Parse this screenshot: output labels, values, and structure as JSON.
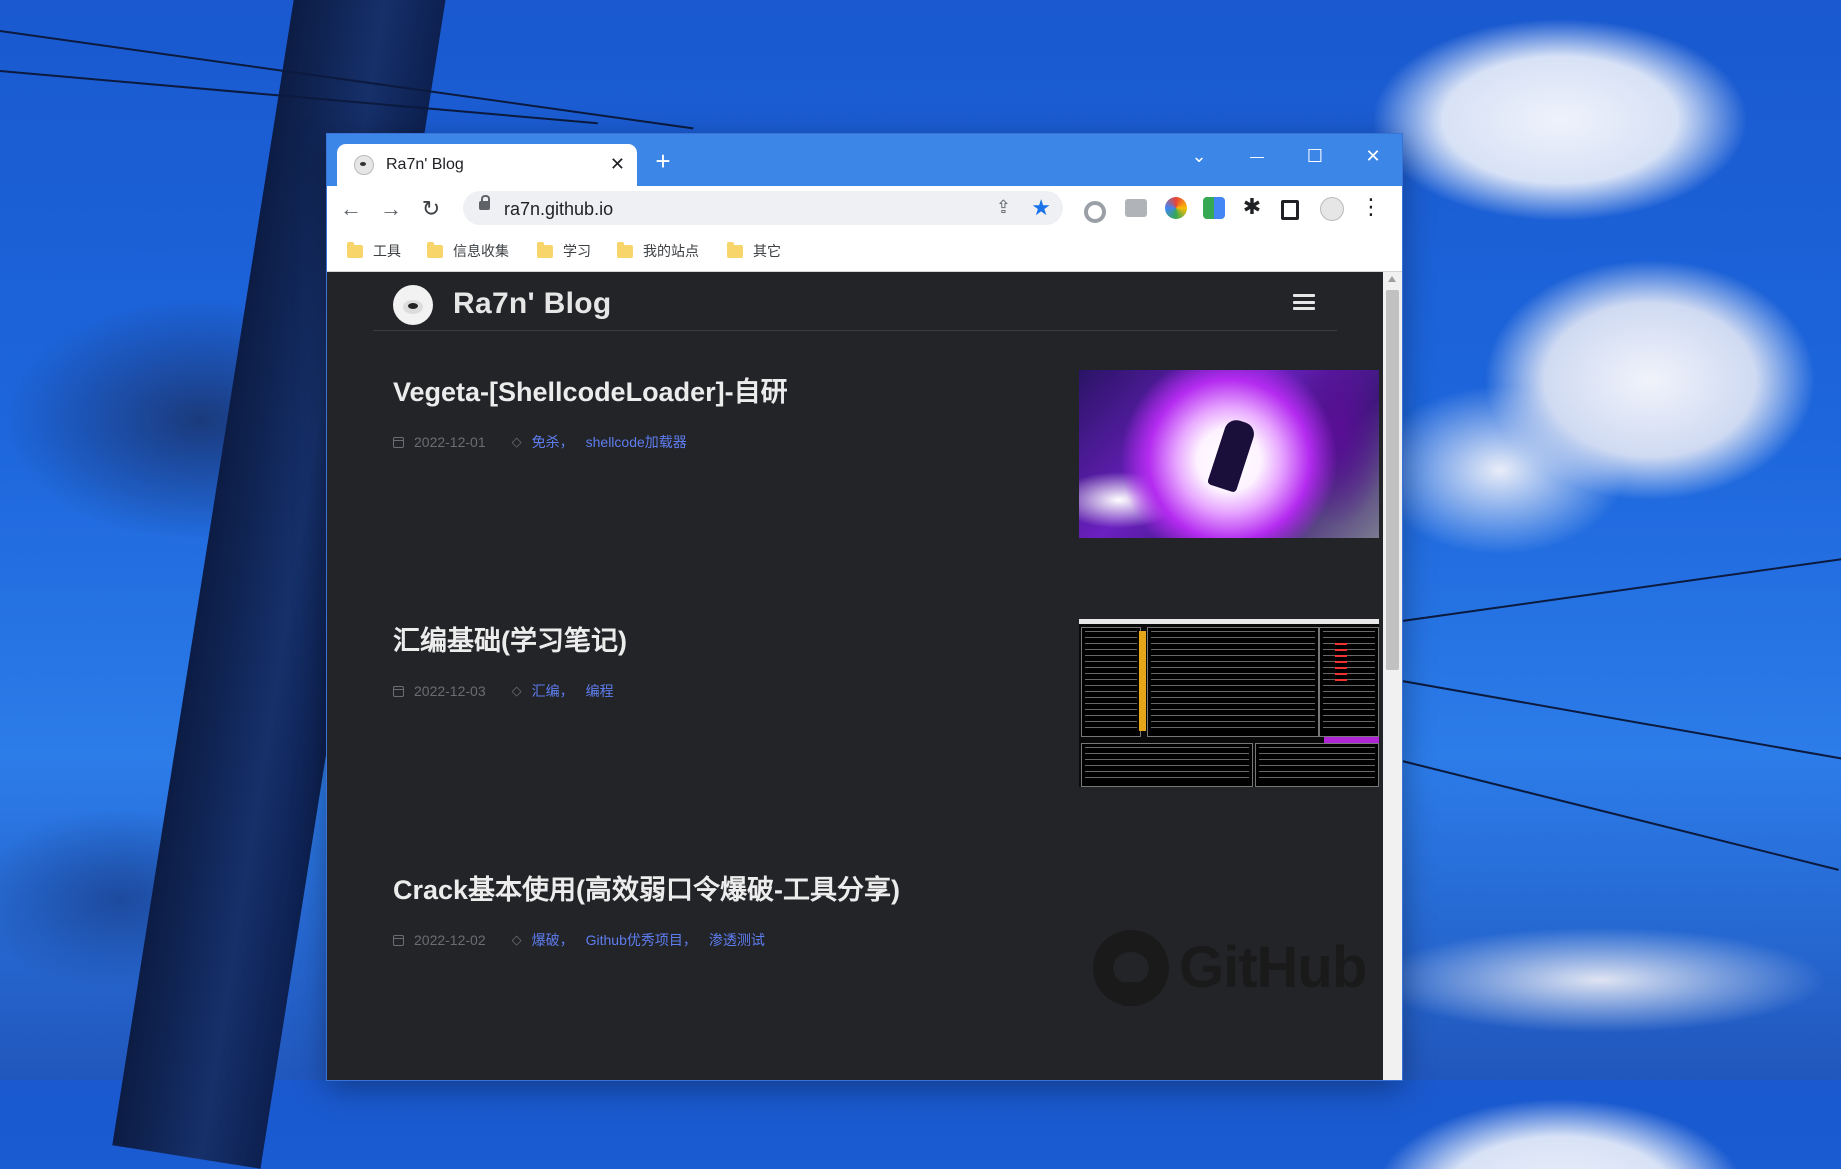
{
  "browser": {
    "tab_title": "Ra7n' Blog",
    "url": "ra7n.github.io",
    "icons": [
      "back-icon",
      "forward-icon",
      "reload-icon",
      "share-icon",
      "star-icon",
      "extensions-icon",
      "sidebar-icon",
      "more-icon"
    ],
    "window_controls": {
      "dropdown": "⌄",
      "minimize": "—",
      "maximize": "☐",
      "close": "✕"
    }
  },
  "bookmarks": [
    {
      "label": "工具"
    },
    {
      "label": "信息收集"
    },
    {
      "label": "学习"
    },
    {
      "label": "我的站点"
    },
    {
      "label": "其它"
    }
  ],
  "site": {
    "title": "Ra7n' Blog"
  },
  "posts": [
    {
      "title": "Vegeta-[ShellcodeLoader]-自研",
      "date": "2022-12-01",
      "tags": [
        "免杀",
        "shellcode加载器"
      ]
    },
    {
      "title": "汇编基础(学习笔记)",
      "date": "2022-12-03",
      "tags": [
        "汇编",
        "编程"
      ]
    },
    {
      "title": "Crack基本使用(高效弱口令爆破-工具分享)",
      "date": "2022-12-02",
      "tags": [
        "爆破",
        "Github优秀项目",
        "渗透测试"
      ],
      "thumb_text": "GitHub"
    }
  ],
  "colors": {
    "titlebar": "#3c86e8",
    "page_background": "#232427",
    "tag_link": "#5e7df0",
    "bookmark_star": "#1a73e8"
  }
}
